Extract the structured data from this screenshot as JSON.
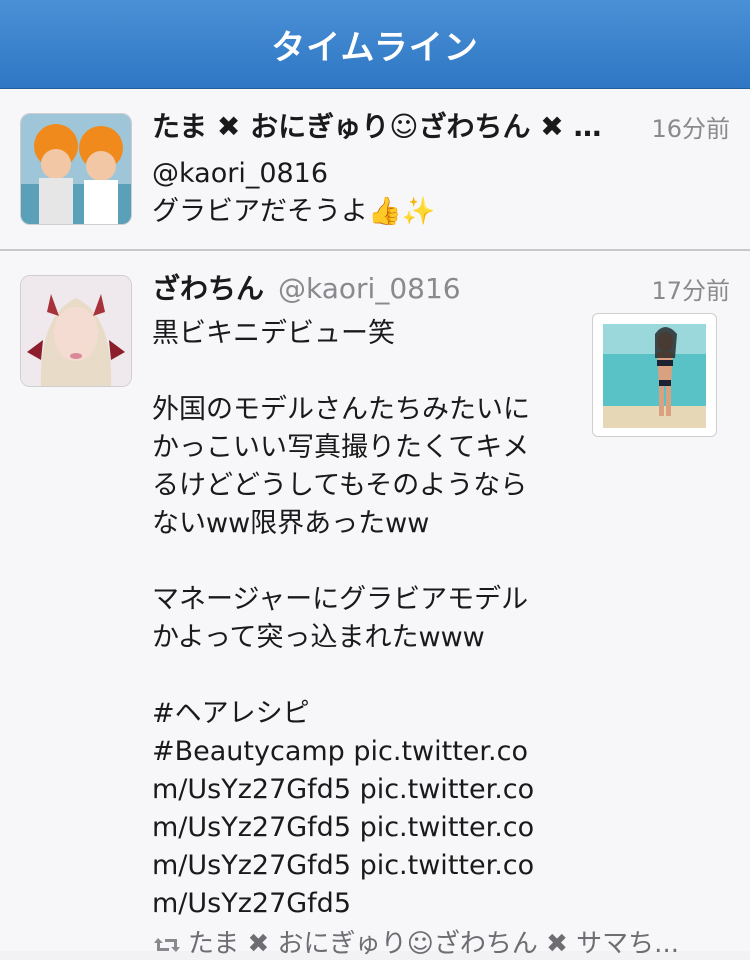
{
  "navbar": {
    "title": "タイムライン"
  },
  "timeline": [
    {
      "name": "たま ✖ おにぎゅり☺ざわちん ✖ サマ...",
      "handle": "",
      "time": "16分前",
      "text": "@kaori_0816\nグラビアだそうよ👍✨",
      "avatar_icon": "two-people-avatar"
    },
    {
      "name": "ざわちん",
      "handle": "@kaori_0816",
      "time": "17分前",
      "text": "黒ビキニデビュー笑\n\n外国のモデルさんたちみたいに\nかっこいい写真撮りたくてキメ\nるけどどうしてもそのようなら\nないww限界あったww\n\nマネージャーにグラビアモデル\nかよって突っ込まれたwww\n\n#ヘアレシピ\n#Beautycamp pic.twitter.co\nm/UsYz27Gfd5 pic.twitter.co\nm/UsYz27Gfd5 pic.twitter.co\nm/UsYz27Gfd5 pic.twitter.co\nm/UsYz27Gfd5",
      "retweeted_by": "たま ✖ おにぎゅり☺ざわちん ✖ サマち...",
      "avatar_icon": "devil-girl-avatar",
      "media_icon": "bikini-beach-photo"
    }
  ],
  "colors": {
    "navbar": "#3a84cf",
    "muted": "#8a8a8e"
  }
}
